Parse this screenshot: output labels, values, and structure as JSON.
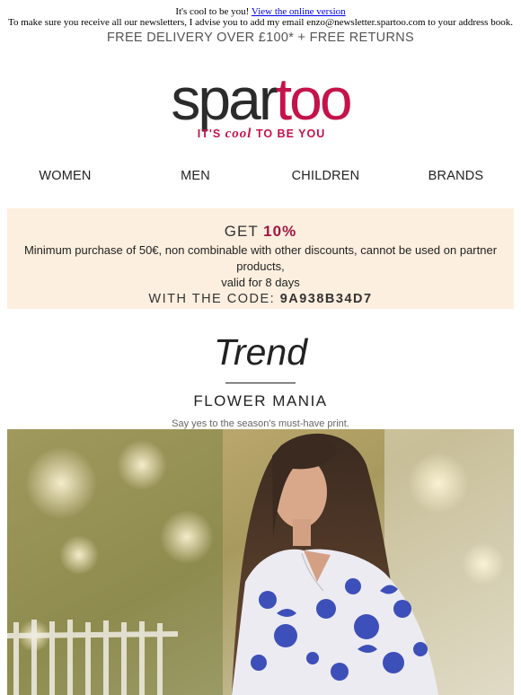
{
  "preheader": {
    "line1_text": "It's cool to be you!",
    "line1_link": "View the online version",
    "line2": "To make sure you receive all our newsletters, I advise you to add my email enzo@newsletter.spartoo.com to your address book."
  },
  "delivery_banner": "FREE DELIVERY OVER £100* + FREE RETURNS",
  "logo": {
    "wordmark_part1": "spar",
    "wordmark_part2": "too",
    "tagline_part1": "IT'S",
    "tagline_cool": "cool",
    "tagline_part2": "TO BE YOU",
    "colors": {
      "dark": "#2b2b2b",
      "brand": "#c4124a"
    }
  },
  "nav": [
    {
      "label": "WOMEN"
    },
    {
      "label": "MEN"
    },
    {
      "label": "CHILDREN"
    },
    {
      "label": "BRANDS"
    }
  ],
  "promo": {
    "get_label": "GET",
    "discount": "10%",
    "conditions_line1": "Minimum purchase of 50€, non combinable with other discounts, cannot be used on partner products,",
    "conditions_line2": "valid for 8 days",
    "code_label": "WITH THE CODE:",
    "code": "9A938B34D7",
    "background": "#fdefdf",
    "accent": "#a3153f"
  },
  "section": {
    "heading": "Trend",
    "subtitle": "FLOWER MANIA",
    "tagline": "Say yes to the season's must-have print."
  },
  "hero_image": {
    "icon": "hero-photo-woman-floral-shirt"
  }
}
